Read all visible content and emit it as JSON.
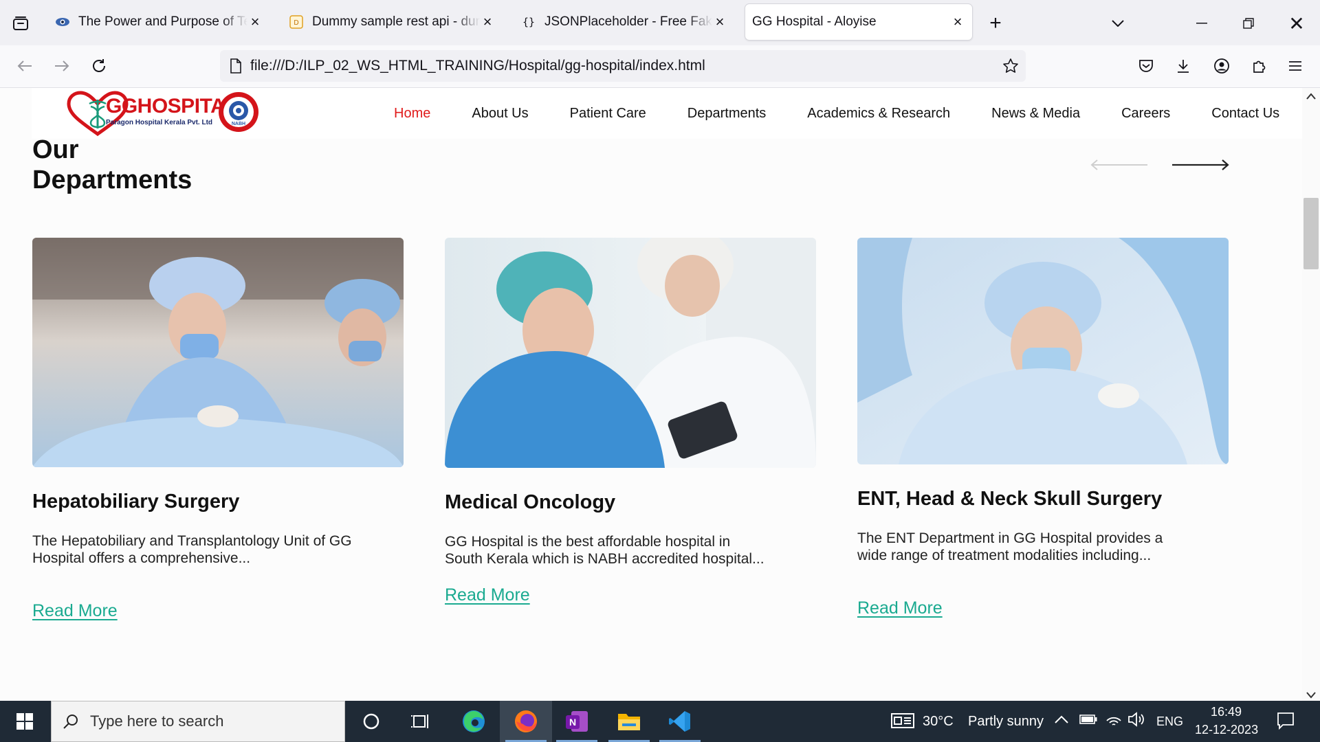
{
  "browser": {
    "tabs": [
      {
        "title": "The Power and Purpose of Team",
        "active": false
      },
      {
        "title": "Dummy sample rest api - dummy",
        "active": false
      },
      {
        "title": "JSONPlaceholder - Free Fake REST API",
        "active": false
      },
      {
        "title": "GG Hospital - Aloyise",
        "active": true
      }
    ],
    "url": "file:///D:/ILP_02_WS_HTML_TRAINING/Hospital/gg-hospital/index.html"
  },
  "site": {
    "logo": {
      "name": "GGHOSPITAL",
      "subtitle": "Paragon Hospital Kerala Pvt. Ltd",
      "badge": "NABH"
    },
    "nav": [
      {
        "label": "Home",
        "active": true
      },
      {
        "label": "About Us",
        "active": false
      },
      {
        "label": "Patient Care",
        "active": false
      },
      {
        "label": "Departments",
        "active": false
      },
      {
        "label": "Academics & Research",
        "active": false
      },
      {
        "label": "News & Media",
        "active": false
      },
      {
        "label": "Careers",
        "active": false
      },
      {
        "label": "Contact Us",
        "active": false
      }
    ],
    "section_title_line1": "Our",
    "section_title_line2": "Departments",
    "departments": [
      {
        "title": "Hepatobiliary Surgery",
        "description": "The Hepatobiliary and Transplantology Unit of GG Hospital offers a comprehensive...",
        "link": "Read More"
      },
      {
        "title": "Medical Oncology",
        "description": "GG Hospital is the best affordable hospital in South Kerala which is NABH accredited hospital...",
        "link": "Read More"
      },
      {
        "title": "ENT, Head & Neck Skull Surgery",
        "description": "The ENT Department in GG Hospital provides a wide range of treatment modalities including...",
        "link": "Read More"
      }
    ],
    "colors": {
      "accent_red": "#e01b1b",
      "link_teal": "#1aaa90",
      "brand_red": "#d4141a",
      "brand_navy": "#1b2a6b"
    }
  },
  "taskbar": {
    "search_placeholder": "Type here to search",
    "weather_temp": "30°C",
    "weather_text": "Partly sunny",
    "language": "ENG",
    "time": "16:49",
    "date": "12-12-2023"
  }
}
